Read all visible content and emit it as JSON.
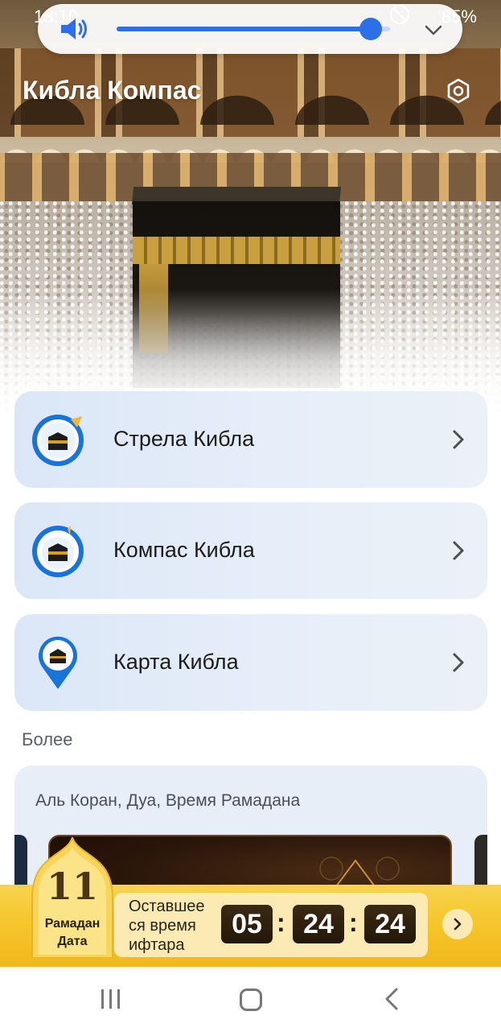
{
  "status_bar": {
    "time": "13:10",
    "battery": "85%"
  },
  "volume_panel": {
    "level_fraction": 0.93
  },
  "header": {
    "title": "Кибла Компас"
  },
  "menu": {
    "items": [
      {
        "label": "Стрела Кибла",
        "icon": "qibla-arrow-icon"
      },
      {
        "label": "Компас Кибла",
        "icon": "qibla-compass-icon"
      },
      {
        "label": "Карта Кибла",
        "icon": "qibla-map-pin-icon"
      }
    ]
  },
  "more": {
    "section_label": "Более",
    "card_title": "Аль Коран, Дуа, Время Рамадана"
  },
  "ramadan_banner": {
    "day_number": "11",
    "day_label": "Рамадан Дата",
    "countdown_label": "Оставшее ся время ифтара",
    "hours": "05",
    "minutes": "24",
    "seconds": "24",
    "separator": ":"
  },
  "colors": {
    "accent_blue": "#2d6ee9",
    "card_bg": "#e0eaf7",
    "banner_gold": "#f5c52a"
  }
}
